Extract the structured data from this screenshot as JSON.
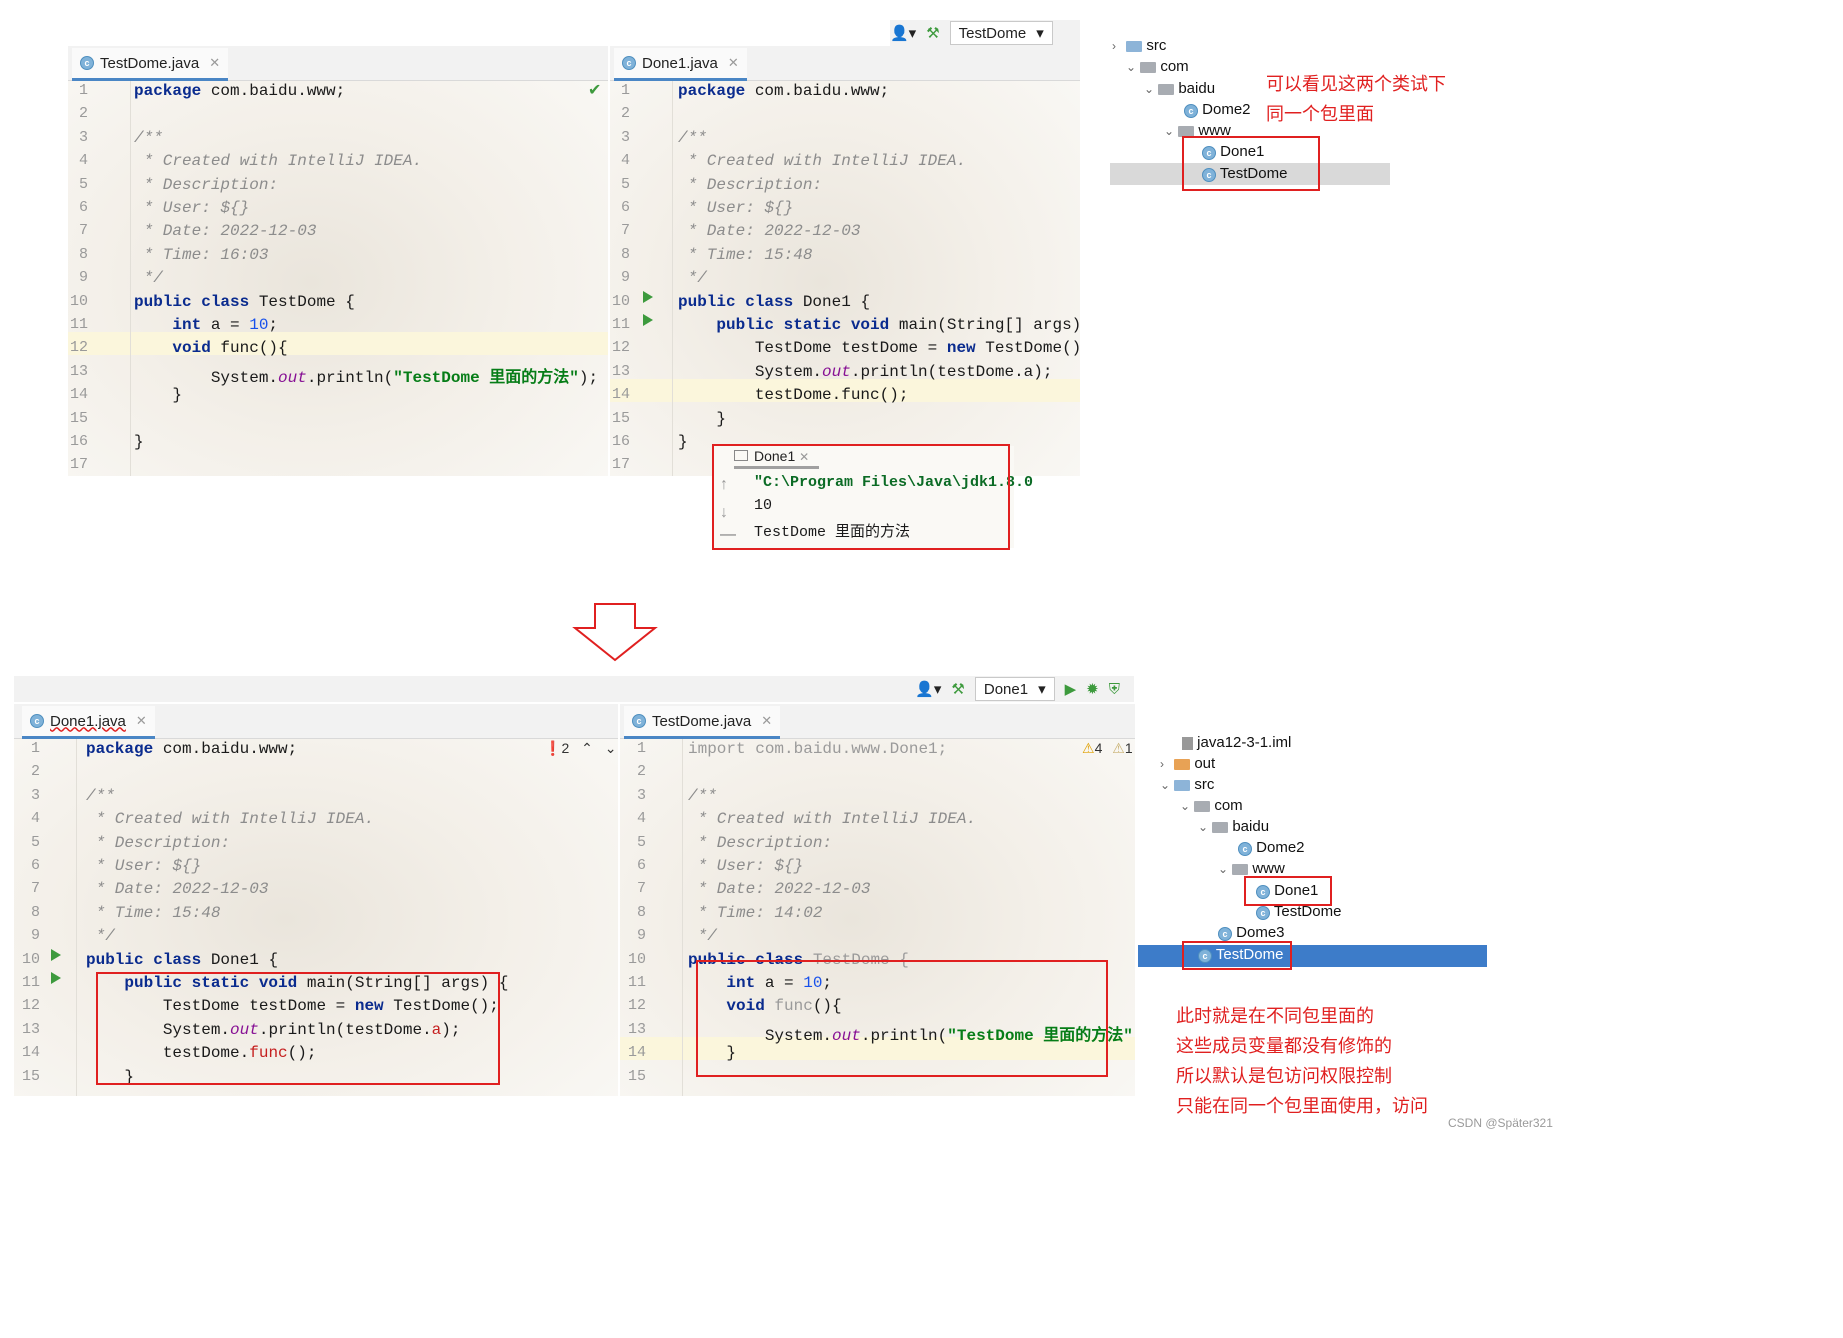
{
  "top": {
    "toolbar": {
      "run_config": "TestDome"
    },
    "left": {
      "tab": "TestDome.java",
      "code": [
        [
          [
            "kw",
            "package"
          ],
          [
            "",
            "com.baidu.www;"
          ]
        ],
        [],
        [
          [
            "cm",
            "/**"
          ]
        ],
        [
          [
            "cm",
            " * Created with IntelliJ IDEA."
          ]
        ],
        [
          [
            "cm",
            " * Description:"
          ]
        ],
        [
          [
            "cm",
            " * User: ${}"
          ]
        ],
        [
          [
            "cm",
            " * Date: 2022-12-03"
          ]
        ],
        [
          [
            "cm",
            " * Time: 16:03"
          ]
        ],
        [
          [
            "cm",
            " */"
          ]
        ],
        [
          [
            "kw",
            "public class "
          ],
          [
            "",
            "TestDome {"
          ]
        ],
        [
          [
            "",
            "    "
          ],
          [
            "kw",
            "int "
          ],
          [
            "",
            "a = "
          ],
          [
            "num",
            "10"
          ],
          [
            "",
            ";"
          ]
        ],
        [
          [
            "",
            "    "
          ],
          [
            "kw",
            "void "
          ],
          [
            "",
            "func(){"
          ]
        ],
        [
          [
            "",
            "        System."
          ],
          [
            "it",
            "out"
          ],
          [
            "",
            ".println("
          ],
          [
            "str",
            "\"TestDome 里面的方法\""
          ],
          [
            "",
            ");"
          ]
        ],
        [
          [
            "",
            "    }"
          ]
        ],
        [],
        [
          [
            "",
            "}"
          ]
        ],
        []
      ]
    },
    "right": {
      "tab": "Done1.java",
      "code": [
        [
          [
            "kw",
            "package"
          ],
          [
            "",
            "com.baidu.www;"
          ]
        ],
        [],
        [
          [
            "cm",
            "/**"
          ]
        ],
        [
          [
            "cm",
            " * Created with IntelliJ IDEA."
          ]
        ],
        [
          [
            "cm",
            " * Description:"
          ]
        ],
        [
          [
            "cm",
            " * User: ${}"
          ]
        ],
        [
          [
            "cm",
            " * Date: 2022-12-03"
          ]
        ],
        [
          [
            "cm",
            " * Time: 15:48"
          ]
        ],
        [
          [
            "cm",
            " */"
          ]
        ],
        [
          [
            "kw",
            "public class "
          ],
          [
            "",
            "Done1 {"
          ]
        ],
        [
          [
            "",
            "    "
          ],
          [
            "kw",
            "public static void "
          ],
          [
            "",
            "main(String[] args) {"
          ]
        ],
        [
          [
            "",
            "        TestDome testDome = "
          ],
          [
            "kw",
            "new "
          ],
          [
            "",
            "TestDome();"
          ]
        ],
        [
          [
            "",
            "        System."
          ],
          [
            "it",
            "out"
          ],
          [
            "",
            ".println(testDome.a);"
          ]
        ],
        [
          [
            "",
            "        testDome.func();"
          ]
        ],
        [
          [
            "",
            "    }"
          ]
        ],
        [
          [
            "",
            "}"
          ]
        ],
        []
      ]
    },
    "console": {
      "tab": "Done1",
      "lines": [
        "\"C:\\Program Files\\Java\\jdk1.8.0",
        "10",
        "TestDome 里面的方法"
      ]
    },
    "tree": {
      "items": [
        "src",
        "com",
        "baidu",
        "Dome2",
        "www",
        "Done1",
        "TestDome"
      ]
    },
    "note": [
      "可以看见这两个类试下",
      "同一个包里面"
    ]
  },
  "bottom": {
    "toolbar": {
      "run_config": "Done1"
    },
    "left": {
      "tab": "Done1.java",
      "error_count": "2",
      "code": [
        [
          [
            "kw",
            "package"
          ],
          [
            "",
            "com.baidu.www;"
          ]
        ],
        [],
        [
          [
            "cm",
            "/**"
          ]
        ],
        [
          [
            "cm",
            " * Created with IntelliJ IDEA."
          ]
        ],
        [
          [
            "cm",
            " * Description:"
          ]
        ],
        [
          [
            "cm",
            " * User: ${}"
          ]
        ],
        [
          [
            "cm",
            " * Date: 2022-12-03"
          ]
        ],
        [
          [
            "cm",
            " * Time: 15:48"
          ]
        ],
        [
          [
            "cm",
            " */"
          ]
        ],
        [
          [
            "kw",
            "public class "
          ],
          [
            "",
            "Done1 {"
          ]
        ],
        [
          [
            "",
            "    "
          ],
          [
            "kw",
            "public static void "
          ],
          [
            "",
            "main(String[] args) {"
          ]
        ],
        [
          [
            "",
            "        TestDome testDome = "
          ],
          [
            "kw",
            "new "
          ],
          [
            "",
            "TestDome();"
          ]
        ],
        [
          [
            "",
            "        System."
          ],
          [
            "it",
            "out"
          ],
          [
            "",
            ".println(testDome."
          ],
          [
            "err",
            "a"
          ],
          [
            "",
            ");"
          ]
        ],
        [
          [
            "",
            "        testDome."
          ],
          [
            "err",
            "func"
          ],
          [
            "",
            "();"
          ]
        ],
        [
          [
            "",
            "    }"
          ]
        ]
      ]
    },
    "right": {
      "tab": "TestDome.java",
      "warn_count": "4",
      "warn2_count": "1",
      "code": [
        [
          [
            "gray",
            "import com.baidu.www.Done1;"
          ]
        ],
        [],
        [
          [
            "cm",
            "/**"
          ]
        ],
        [
          [
            "cm",
            " * Created with IntelliJ IDEA."
          ]
        ],
        [
          [
            "cm",
            " * Description:"
          ]
        ],
        [
          [
            "cm",
            " * User: ${}"
          ]
        ],
        [
          [
            "cm",
            " * Date: 2022-12-03"
          ]
        ],
        [
          [
            "cm",
            " * Time: 14:02"
          ]
        ],
        [
          [
            "cm",
            " */"
          ]
        ],
        [
          [
            "kw",
            "public class "
          ],
          [
            "gray",
            "TestDome {"
          ]
        ],
        [
          [
            "",
            "    "
          ],
          [
            "kw",
            "int "
          ],
          [
            "",
            "a = "
          ],
          [
            "num",
            "10"
          ],
          [
            "",
            ";"
          ]
        ],
        [
          [
            "",
            "    "
          ],
          [
            "kw",
            "void "
          ],
          [
            "gray",
            "func"
          ],
          [
            "",
            "(){"
          ]
        ],
        [
          [
            "",
            "        System."
          ],
          [
            "it",
            "out"
          ],
          [
            "",
            ".println("
          ],
          [
            "str",
            "\"TestDome 里面的方法\""
          ],
          [
            "",
            ");"
          ]
        ],
        [
          [
            "",
            "    }"
          ]
        ],
        []
      ]
    },
    "tree": {
      "items": [
        "java12-3-1.iml",
        "out",
        "src",
        "com",
        "baidu",
        "Dome2",
        "www",
        "Done1",
        "TestDome",
        "Dome3",
        "TestDome"
      ]
    },
    "note": [
      "此时就是在不同包里面的",
      "这些成员变量都没有修饰的",
      "所以默认是包访问权限控制",
      "只能在同一个包里面使用，访问"
    ]
  },
  "watermark": "CSDN @Späte​r321",
  "colors": {
    "red": "#e02020",
    "keyword": "#0a2b8e",
    "string": "#067d17",
    "selection": "#3d7cc9"
  }
}
